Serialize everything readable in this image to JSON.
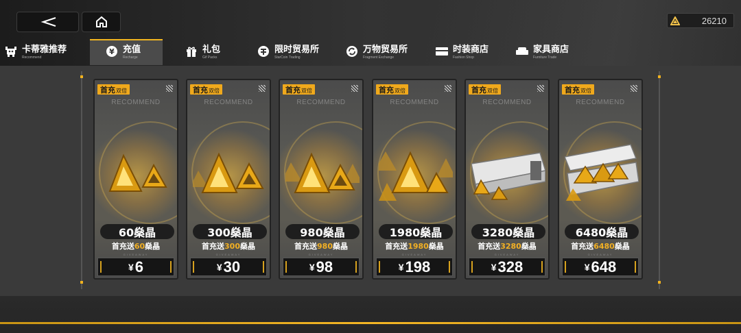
{
  "header": {
    "back_icon": "back-arrow-icon",
    "home_icon": "home-icon",
    "currency": {
      "icon": "triangle-crystal-icon",
      "value": "26210"
    }
  },
  "tabs": [
    {
      "label": "卡蒂雅推荐",
      "sub": "Recommend",
      "icon": "robot-icon",
      "active": false
    },
    {
      "label": "充值",
      "sub": "Recharge",
      "icon": "yen-icon",
      "active": true
    },
    {
      "label": "礼包",
      "sub": "Gif Packs",
      "icon": "gift-icon",
      "active": false
    },
    {
      "label": "限时贸易所",
      "sub": "StarCoin Trading",
      "icon": "coin-icon",
      "active": false
    },
    {
      "label": "万物贸易所",
      "sub": "Fragment Exchange",
      "icon": "refresh-icon",
      "active": false
    },
    {
      "label": "时装商店",
      "sub": "Fashion Shop",
      "icon": "wardrobe-icon",
      "active": false
    },
    {
      "label": "家具商店",
      "sub": "Furniture Trade",
      "icon": "sofa-icon",
      "active": false
    }
  ],
  "cards": [
    {
      "badge": "首充",
      "badge_sub": "双倍",
      "watermark": "RECOMMEND",
      "amount": "60燊晶",
      "bonus_pre": "首充送",
      "bonus_num": "60",
      "bonus_post": "燊晶",
      "yen": "¥",
      "price": "6",
      "giveaway": "GIVEAWAY"
    },
    {
      "badge": "首充",
      "badge_sub": "双倍",
      "watermark": "RECOMMEND",
      "amount": "300燊晶",
      "bonus_pre": "首充送",
      "bonus_num": "300",
      "bonus_post": "燊晶",
      "yen": "¥",
      "price": "30",
      "giveaway": "GIVEAWAY"
    },
    {
      "badge": "首充",
      "badge_sub": "双倍",
      "watermark": "RECOMMEND",
      "amount": "980燊晶",
      "bonus_pre": "首充送",
      "bonus_num": "980",
      "bonus_post": "燊晶",
      "yen": "¥",
      "price": "98",
      "giveaway": "GIVEAWAY"
    },
    {
      "badge": "首充",
      "badge_sub": "双倍",
      "watermark": "RECOMMEND",
      "amount": "1980燊晶",
      "bonus_pre": "首充送",
      "bonus_num": "1980",
      "bonus_post": "燊晶",
      "yen": "¥",
      "price": "198",
      "giveaway": "GIVEAWAY"
    },
    {
      "badge": "首充",
      "badge_sub": "双倍",
      "watermark": "RECOMMEND",
      "amount": "3280燊晶",
      "bonus_pre": "首充送",
      "bonus_num": "3280",
      "bonus_post": "燊晶",
      "yen": "¥",
      "price": "328",
      "giveaway": "GIVEAWAY"
    },
    {
      "badge": "首充",
      "badge_sub": "双倍",
      "watermark": "RECOMMEND",
      "amount": "6480燊晶",
      "bonus_pre": "首充送",
      "bonus_num": "6480",
      "bonus_post": "燊晶",
      "yen": "¥",
      "price": "648",
      "giveaway": "GIVEAWAY"
    }
  ],
  "colors": {
    "accent": "#f2b520",
    "card_bg": "#555550",
    "price_bg": "#151515"
  }
}
